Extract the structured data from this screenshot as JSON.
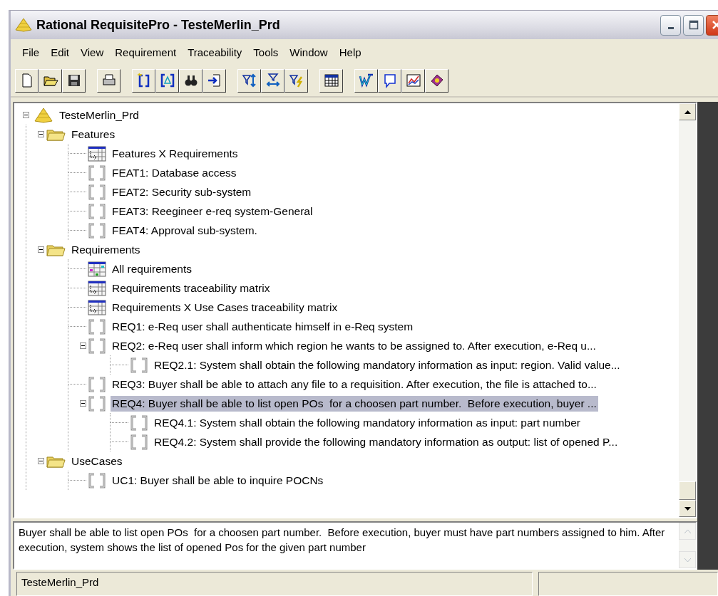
{
  "window": {
    "title": "Rational RequisitePro - TesteMerlin_Prd"
  },
  "menu": [
    {
      "label": "File"
    },
    {
      "label": "Edit"
    },
    {
      "label": "View"
    },
    {
      "label": "Requirement"
    },
    {
      "label": "Traceability"
    },
    {
      "label": "Tools"
    },
    {
      "label": "Window"
    },
    {
      "label": "Help"
    }
  ],
  "tree": [
    {
      "label": "TesteMerlin_Prd",
      "kind": "project",
      "expanded": true,
      "selected": false,
      "children": [
        {
          "label": "Features",
          "kind": "folder",
          "expanded": true,
          "selected": false,
          "children": [
            {
              "label": "Features X Requirements",
              "kind": "matrix",
              "selected": false
            },
            {
              "label": "FEAT1: Database access",
              "kind": "requirement",
              "selected": false
            },
            {
              "label": "FEAT2: Security sub-system",
              "kind": "requirement",
              "selected": false
            },
            {
              "label": "FEAT3: Reegineer e-req system-General",
              "kind": "requirement",
              "selected": false
            },
            {
              "label": "FEAT4: Approval sub-system.",
              "kind": "requirement",
              "selected": false
            }
          ]
        },
        {
          "label": "Requirements",
          "kind": "folder",
          "expanded": true,
          "selected": false,
          "children": [
            {
              "label": "All requirements",
              "kind": "view",
              "selected": false
            },
            {
              "label": "Requirements traceability matrix",
              "kind": "matrix",
              "selected": false
            },
            {
              "label": "Requirements X Use Cases traceability matrix",
              "kind": "matrix",
              "selected": false
            },
            {
              "label": "REQ1: e-Req user shall authenticate himself in e-Req system",
              "kind": "requirement",
              "selected": false
            },
            {
              "label": "REQ2: e-Req user shall inform which region he wants to be assigned to. After execution, e-Req u...",
              "kind": "requirement",
              "expanded": true,
              "selected": false,
              "children": [
                {
                  "label": "REQ2.1: System shall obtain the following mandatory information as input: region. Valid value...",
                  "kind": "requirement",
                  "selected": false
                }
              ]
            },
            {
              "label": "REQ3: Buyer shall be able to attach any file to a requisition. After execution, the file is attached to...",
              "kind": "requirement",
              "selected": false
            },
            {
              "label": "REQ4: Buyer shall be able to list open POs  for a choosen part number.  Before execution, buyer ...",
              "kind": "requirement",
              "expanded": true,
              "selected": true,
              "children": [
                {
                  "label": "REQ4.1: System shall obtain the following mandatory information as input: part number",
                  "kind": "requirement",
                  "selected": false
                },
                {
                  "label": "REQ4.2: System shall provide the following mandatory information as output: list of opened P...",
                  "kind": "requirement",
                  "selected": false
                }
              ]
            }
          ]
        },
        {
          "label": "UseCases",
          "kind": "folder",
          "expanded": true,
          "selected": false,
          "children": [
            {
              "label": "UC1: Buyer shall be able to inquire POCNs",
              "kind": "requirement",
              "selected": false
            }
          ]
        }
      ]
    }
  ],
  "description": "Buyer shall be able to list open POs  for a choosen part number.  Before execution, buyer must have part numbers assigned to him. After execution, system shows the list of opened Pos for the given part number",
  "status_bar": {
    "panel_1": "TesteMerlin_Prd"
  }
}
